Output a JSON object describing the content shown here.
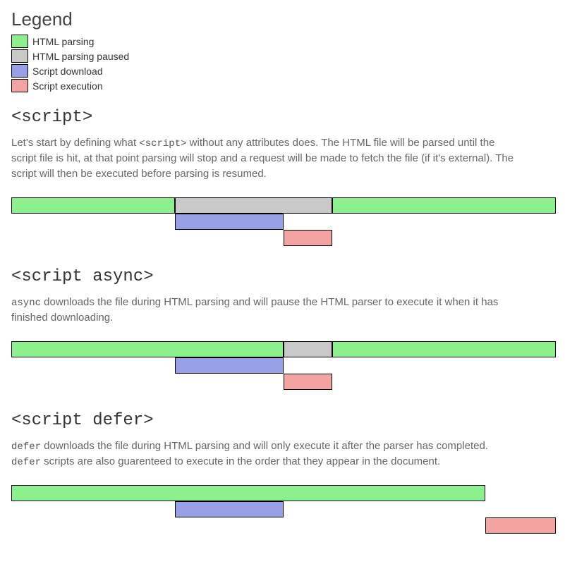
{
  "legend": {
    "title": "Legend",
    "items": [
      {
        "label": "HTML parsing",
        "state": "parsing"
      },
      {
        "label": "HTML parsing paused",
        "state": "paused"
      },
      {
        "label": "Script download",
        "state": "download"
      },
      {
        "label": "Script execution",
        "state": "execution"
      }
    ]
  },
  "colors": {
    "parsing": "#8cf08c",
    "paused": "#c9c9c9",
    "download": "#9aa0e8",
    "execution": "#f4a3a3"
  },
  "sections": [
    {
      "id": "plain",
      "heading": "<script>",
      "desc_parts": [
        "Let's start by defining what ",
        "<script>",
        " without any attributes does. The HTML file will be parsed until the script file is hit, at that point parsing will stop and a request will be made to fetch the file (if it's external). The script will then be executed before parsing is resumed."
      ],
      "timeline": {
        "rows": [
          [
            {
              "state": "parsing",
              "start": 0,
              "end": 30
            },
            {
              "state": "paused",
              "start": 30,
              "end": 59
            },
            {
              "state": "parsing",
              "start": 59,
              "end": 100
            }
          ],
          [
            {
              "state": "download",
              "start": 30,
              "end": 50
            }
          ],
          [
            {
              "state": "execution",
              "start": 50,
              "end": 59
            }
          ]
        ]
      }
    },
    {
      "id": "async",
      "heading": "<script async>",
      "desc_parts": [
        "",
        "async",
        " downloads the file during HTML parsing and will pause the HTML parser to execute it when it has finished downloading."
      ],
      "timeline": {
        "rows": [
          [
            {
              "state": "parsing",
              "start": 0,
              "end": 50
            },
            {
              "state": "paused",
              "start": 50,
              "end": 59
            },
            {
              "state": "parsing",
              "start": 59,
              "end": 100
            }
          ],
          [
            {
              "state": "download",
              "start": 30,
              "end": 50
            }
          ],
          [
            {
              "state": "execution",
              "start": 50,
              "end": 59
            }
          ]
        ]
      }
    },
    {
      "id": "defer",
      "heading": "<script defer>",
      "desc_parts": [
        "",
        "defer",
        " downloads the file during HTML parsing and will only execute it after the parser has completed. ",
        "defer",
        " scripts are also guarenteed to execute in the order that they appear in the document."
      ],
      "timeline": {
        "rows": [
          [
            {
              "state": "parsing",
              "start": 0,
              "end": 87
            }
          ],
          [
            {
              "state": "download",
              "start": 30,
              "end": 50
            }
          ],
          [
            {
              "state": "execution",
              "start": 87,
              "end": 100
            }
          ]
        ]
      }
    }
  ]
}
